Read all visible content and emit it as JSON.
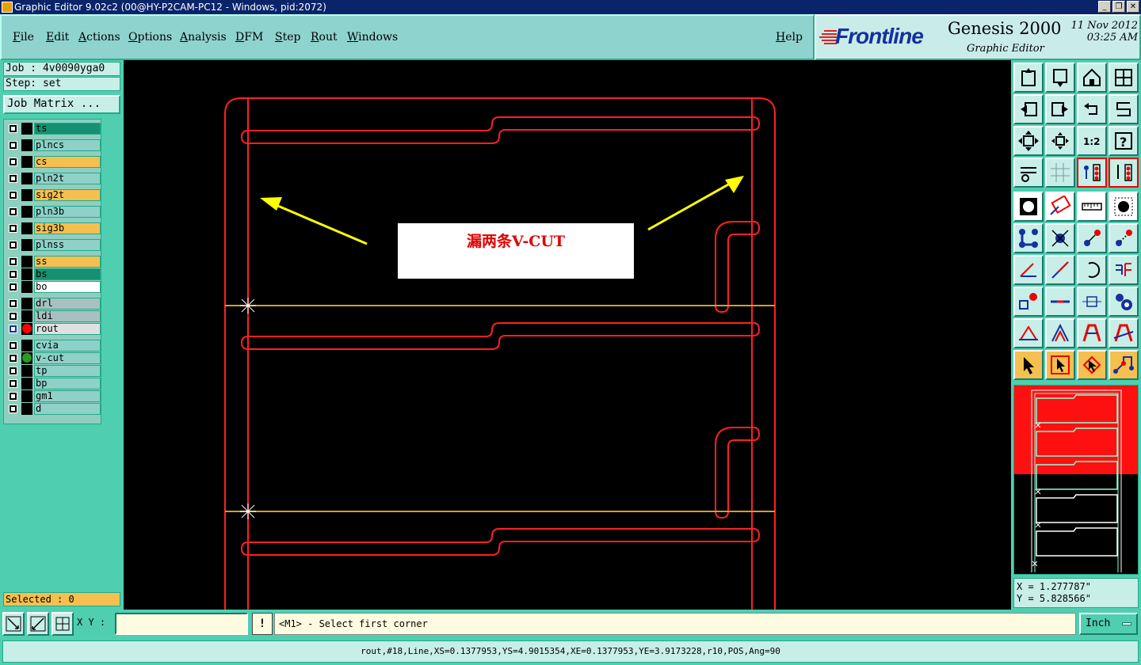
{
  "window": {
    "title": "Graphic Editor 9.02c2 (00@HY-P2CAM-PC12 - Windows, pid:2072)"
  },
  "menu": {
    "items": [
      "File",
      "Edit",
      "Actions",
      "Options",
      "Analysis",
      "DFM",
      "Step",
      "Rout",
      "Windows"
    ],
    "help": "Help"
  },
  "branding": {
    "logo": "Frontline",
    "product": "Genesis 2000",
    "subtitle": "Graphic Editor",
    "date": "11 Nov 2012",
    "time": "03:25 AM"
  },
  "job": {
    "job_line": "Job : 4v0090yga0",
    "step_line": "Step: set",
    "matrix_button": "Job Matrix ..."
  },
  "layers": [
    {
      "name": "ts",
      "color": "#159070",
      "marker": ""
    },
    {
      "name": "plncs",
      "color": "#8fd0c8",
      "marker": ""
    },
    {
      "name": "cs",
      "color": "#f5c050",
      "marker": ""
    },
    {
      "name": "pln2t",
      "color": "#8fd0c8",
      "marker": ""
    },
    {
      "name": "sig2t",
      "color": "#f5c050",
      "marker": ""
    },
    {
      "name": "pln3b",
      "color": "#8fd0c8",
      "marker": ""
    },
    {
      "name": "sig3b",
      "color": "#f5c050",
      "marker": ""
    },
    {
      "name": "plnss",
      "color": "#8fd0c8",
      "marker": ""
    },
    {
      "name": "ss",
      "color": "#f5c050",
      "marker": ""
    },
    {
      "name": "bs",
      "color": "#159070",
      "marker": ""
    },
    {
      "name": "bo",
      "color": "#ffffff",
      "marker": ""
    },
    {
      "name": "drl",
      "color": "#a8c0c0",
      "marker": ""
    },
    {
      "name": "ldi",
      "color": "#a8c0c0",
      "marker": ""
    },
    {
      "name": "rout",
      "color": "#e0e0e0",
      "marker": "#ff0000"
    },
    {
      "name": "cvia",
      "color": "#8fd0c8",
      "marker": ""
    },
    {
      "name": "v-cut",
      "color": "#8fd0c8",
      "marker": "#2a9a20"
    },
    {
      "name": "tp",
      "color": "#8fd0c8",
      "marker": ""
    },
    {
      "name": "bp",
      "color": "#8fd0c8",
      "marker": ""
    },
    {
      "name": "gm1",
      "color": "#8fd0c8",
      "marker": ""
    },
    {
      "name": "d",
      "color": "#8fd0c8",
      "marker": ""
    }
  ],
  "selection": {
    "label": "Selected : 0"
  },
  "annotation": {
    "text": "漏两条V-CUT"
  },
  "readout": {
    "x": "X = 1.277787\"",
    "y": "Y = 5.828566\""
  },
  "bottom": {
    "xy_label": "X Y :",
    "xy_value": "",
    "bang": "!",
    "prompt": "<M1> - Select first corner",
    "unit": "Inch"
  },
  "status": {
    "text": "rout,#18,Line,XS=0.1377953,YS=4.9015354,XE=0.1377953,YE=3.9173228,r10,POS,Ang=90"
  },
  "colors": {
    "accent": "#4fcfb0",
    "rout": "#ff0000",
    "vcut": "#d4a020",
    "arrow": "#ffff00"
  }
}
